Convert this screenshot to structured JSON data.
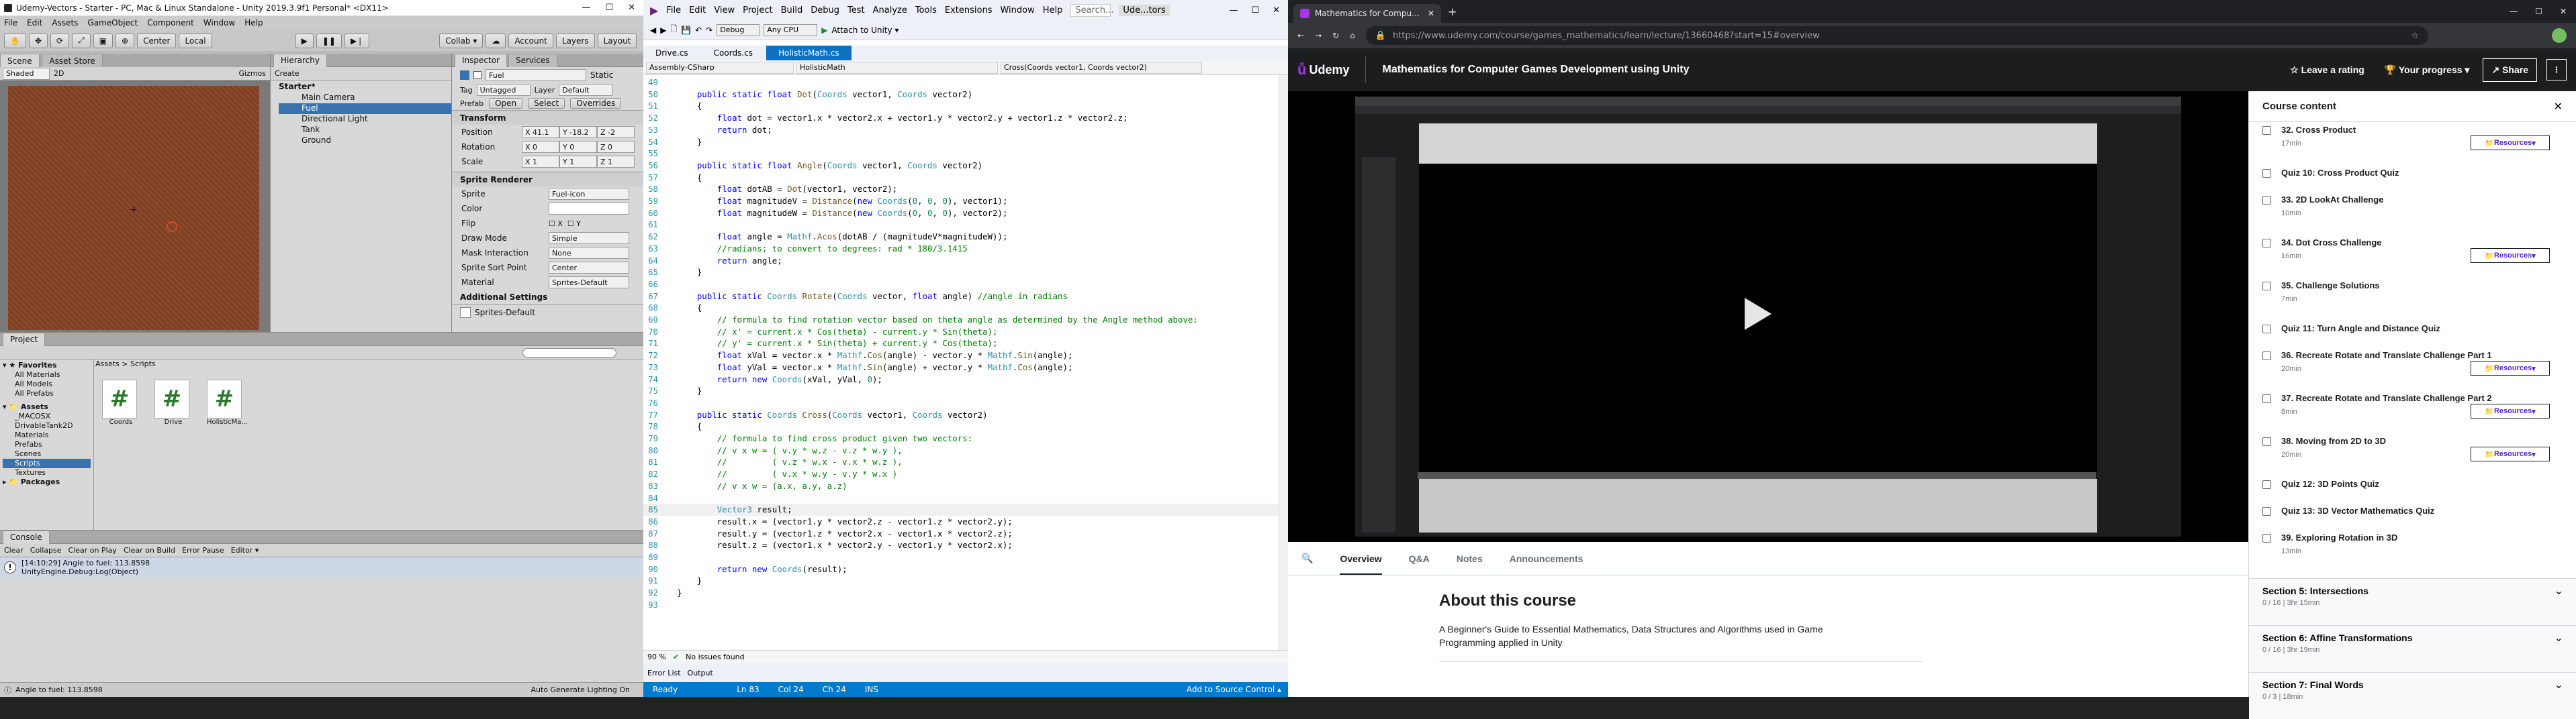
{
  "unity": {
    "title": "Udemy-Vectors - Starter - PC, Mac & Linux Standalone - Unity 2019.3.9f1 Personal* <DX11>",
    "menu": [
      "File",
      "Edit",
      "Assets",
      "GameObject",
      "Component",
      "Window",
      "Help"
    ],
    "tool": {
      "center": "Center",
      "local": "Local",
      "collab": "Collab ▾",
      "account": "Account",
      "layers": "Layers",
      "layout": "Layout"
    },
    "scene_tabs": [
      "Scene",
      "Asset Store"
    ],
    "scene_shaded": "Shaded",
    "scene_2d": "2D",
    "scene_gizmos": "Gizmos",
    "hierarchy": {
      "tab": "Hierarchy",
      "create": "Create",
      "root": "Starter*",
      "items": [
        "Main Camera",
        "Fuel",
        "Directional Light",
        "Tank",
        "Ground"
      ]
    },
    "inspector": {
      "tab": "Inspector",
      "tab2": "Services",
      "name": "Fuel",
      "static": "Static",
      "tag_label": "Tag",
      "tag": "Untagged",
      "layer_label": "Layer",
      "layer": "Default",
      "prefab_label": "Prefab",
      "prefab_open": "Open",
      "prefab_select": "Select",
      "prefab_overrides": "Overrides",
      "transform": "Transform",
      "position": "Position",
      "pos": [
        "41.1",
        "-18.2",
        "-2"
      ],
      "rotation": "Rotation",
      "rot": [
        "0",
        "0",
        "0"
      ],
      "scale": "Scale",
      "scl": [
        "1",
        "1",
        "1"
      ],
      "sprite_renderer": "Sprite Renderer",
      "sprite_label": "Sprite",
      "sprite": "Fuel-icon",
      "color_label": "Color",
      "flip_label": "Flip",
      "draw_mode_label": "Draw Mode",
      "draw_mode": "Simple",
      "mask_label": "Mask Interaction",
      "mask": "None",
      "sort_label": "Sprite Sort Point",
      "sort": "Center",
      "material_label": "Material",
      "material": "Sprites-Default",
      "additional": "Additional Settings",
      "material_footer": "Sprites-Default"
    },
    "project": {
      "tab": "Project",
      "favorites": "Favorites",
      "fav_items": [
        "All Materials",
        "All Models",
        "All Prefabs"
      ],
      "assets": "Assets",
      "asset_items": [
        "_MACOSX",
        "DrivableTank2D",
        "Materials",
        "Prefabs",
        "Scenes",
        "Scripts",
        "Textures"
      ],
      "packages": "Packages",
      "breadcrumb": "Assets > Scripts",
      "files": [
        "Coords",
        "Drive",
        "HolisticMa..."
      ]
    },
    "console": {
      "tab": "Console",
      "buttons": [
        "Clear",
        "Collapse",
        "Clear on Play",
        "Clear on Build",
        "Error Pause",
        "Editor ▾"
      ],
      "log1": "[14:10:29] Angle to fuel: 113.8598",
      "log2": "UnityEngine.Debug:Log(Object)"
    },
    "status": "Angle to fuel: 113.8598",
    "status_right": "Auto Generate Lighting On"
  },
  "vs": {
    "menu": [
      "File",
      "Edit",
      "View",
      "Project",
      "Build",
      "Debug",
      "Test",
      "Analyze",
      "Tools",
      "Extensions",
      "Window",
      "Help"
    ],
    "search": "Search...",
    "solution": "Ude...tors",
    "config": "Debug",
    "platform": "Any CPU",
    "attach": "Attach to Unity ▾",
    "tabs": [
      "Drive.cs",
      "Coords.cs",
      "HolisticMath.cs"
    ],
    "nav": [
      "Assembly-CSharp",
      "HolisticMath",
      "Cross(Coords vector1, Coords vector2)"
    ],
    "zoom": "90 %",
    "issues": "No issues found",
    "bottom_tabs": [
      "Error List",
      "Output"
    ],
    "status": {
      "ready": "Ready",
      "ln": "Ln 83",
      "col": "Col 24",
      "ch": "Ch 24",
      "ins": "INS",
      "source": "Add to Source Control ▴"
    }
  },
  "chrome": {
    "tab_title": "Mathematics for Computer Ga...",
    "url": "https://www.udemy.com/course/games_mathematics/learn/lecture/13660468?start=15#overview",
    "udemy_logo": "Udemy",
    "course_title": "Mathematics for Computer Games Development using Unity",
    "leave_rating": "Leave a rating",
    "progress": "Your progress",
    "share": "Share",
    "tabs": [
      "Overview",
      "Q&A",
      "Notes",
      "Announcements"
    ],
    "about": "About this course",
    "about_text": "A Beginner's Guide to Essential Mathematics, Data Structures and Algorithms used in Game Programming applied in Unity",
    "sidebar_title": "Course content",
    "items": [
      {
        "title": "32. Cross Product",
        "meta": "17min",
        "res": true,
        "video": true
      },
      {
        "title": "Quiz 10: Cross Product Quiz",
        "meta": "",
        "res": false
      },
      {
        "title": "33. 2D LookAt Challenge",
        "meta": "10min",
        "res": false
      },
      {
        "title": "34. Dot Cross Challenge",
        "meta": "16min",
        "res": true
      },
      {
        "title": "35. Challenge Solutions",
        "meta": "7min",
        "res": false
      },
      {
        "title": "Quiz 11: Turn Angle and Distance Quiz",
        "meta": "",
        "res": false
      },
      {
        "title": "36. Recreate Rotate and Translate Challenge Part 1",
        "meta": "20min",
        "res": true
      },
      {
        "title": "37. Recreate Rotate and Translate Challenge Part 2",
        "meta": "8min",
        "res": true
      },
      {
        "title": "38. Moving from 2D to 3D",
        "meta": "20min",
        "res": true
      },
      {
        "title": "Quiz 12: 3D Points Quiz",
        "meta": "",
        "res": false
      },
      {
        "title": "Quiz 13: 3D Vector Mathematics Quiz",
        "meta": "",
        "res": false
      },
      {
        "title": "39. Exploring Rotation in 3D",
        "meta": "13min",
        "res": false
      }
    ],
    "resources": "Resources",
    "sections": [
      {
        "title": "Section 5: Intersections",
        "meta": "0 / 16 | 3hr 15min"
      },
      {
        "title": "Section 6: Affine Transformations",
        "meta": "0 / 16 | 3hr 19min"
      },
      {
        "title": "Section 7: Final Words",
        "meta": "0 / 3 | 18min"
      }
    ]
  }
}
